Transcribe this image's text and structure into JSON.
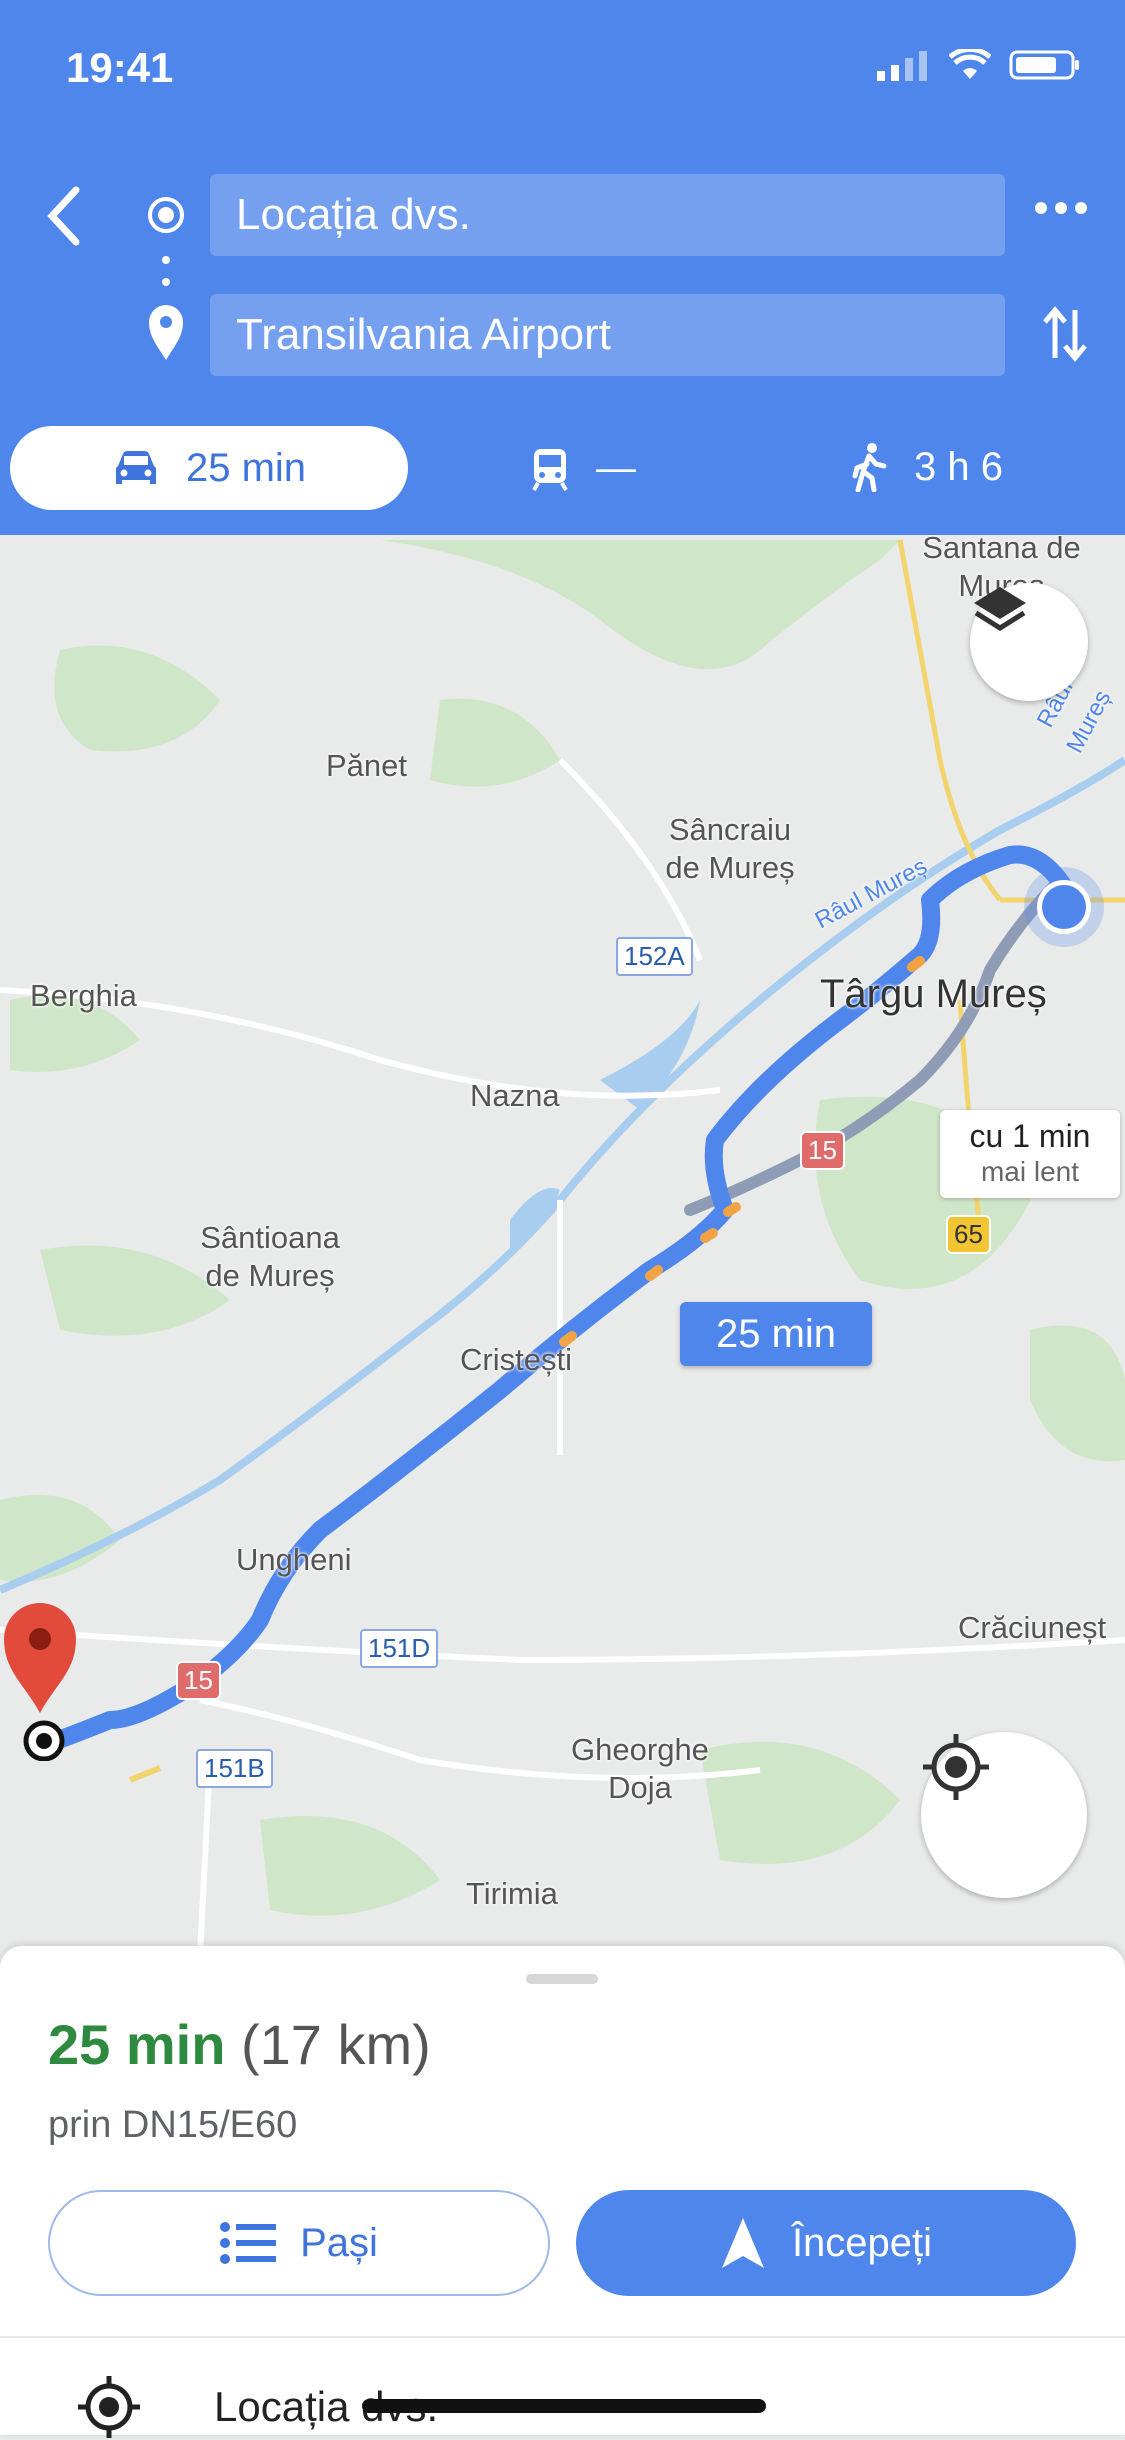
{
  "status": {
    "time": "19:41"
  },
  "route": {
    "origin": "Locația dvs.",
    "destination": "Transilvania Airport"
  },
  "modes": {
    "car": "25 min",
    "transit": "—",
    "walk": "3 h 6"
  },
  "map": {
    "places": {
      "santana": "Santana de Mureș",
      "panet": "Pănet",
      "sancraiu": "Sâncraiu de Mureș",
      "berghia": "Berghia",
      "targu_mures": "Târgu Mureș",
      "nazna": "Nazna",
      "santioana": "Sântioana de Mureș",
      "cristesti": "Cristești",
      "ungheni": "Ungheni",
      "craciunesti": "Crăciuneșt",
      "gheorghe_doja": "Gheorghe Doja",
      "tirimia": "Tirimia",
      "river_1": "Râul Mureș",
      "river_2": "Râul Mureș"
    },
    "roads": {
      "r152a": "152A",
      "r15_a": "15",
      "r65": "65",
      "r151d": "151D",
      "r15_b": "15",
      "r151b": "151B"
    },
    "route_time": "25 min",
    "alt_route_line1": "cu 1 min",
    "alt_route_line2": "mai lent"
  },
  "sheet": {
    "duration": "25 min",
    "distance": "(17 km)",
    "via": "prin DN15/E60",
    "steps_label": "Pași",
    "start_label": "Începeți",
    "location_row": "Locația dvs."
  },
  "colors": {
    "header_blue": "#4f86ec",
    "route_blue": "#4f86ec",
    "duration_green": "#2d8a3e"
  }
}
